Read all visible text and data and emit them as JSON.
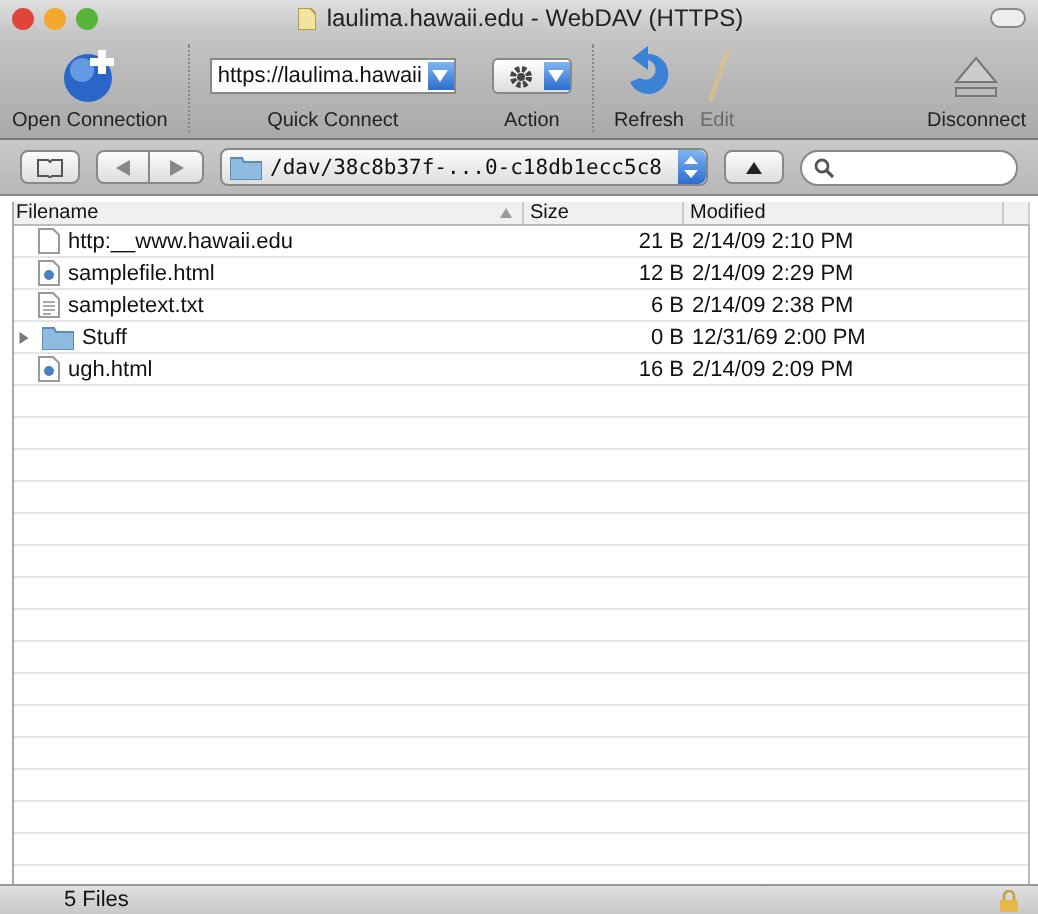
{
  "window": {
    "title": "laulima.hawaii.edu - WebDAV (HTTPS)"
  },
  "toolbar": [
    {
      "kind": "open",
      "label": "Open Connection",
      "disabled": false
    },
    {
      "kind": "quick",
      "label": "Quick Connect",
      "value": "https://laulima.hawaii",
      "disabled": false
    },
    {
      "kind": "action",
      "label": "Action",
      "disabled": false
    },
    {
      "kind": "refresh",
      "label": "Refresh",
      "disabled": false
    },
    {
      "kind": "edit",
      "label": "Edit",
      "disabled": true
    },
    {
      "kind": "disconnect",
      "label": "Disconnect",
      "disabled": false
    }
  ],
  "path": {
    "value": "/dav/38c8b37f-...0-c18db1ecc5c8"
  },
  "table": {
    "columns": [
      "Filename",
      "Size",
      "Modified"
    ],
    "rows": [
      {
        "kind": "file",
        "name": "http:__www.hawaii.edu",
        "size": "21 B",
        "modified": "2/14/09 2:10 PM"
      },
      {
        "kind": "html",
        "name": "samplefile.html",
        "size": "12 B",
        "modified": "2/14/09 2:29 PM"
      },
      {
        "kind": "text",
        "name": "sampletext.txt",
        "size": "6 B",
        "modified": "2/14/09 2:38 PM"
      },
      {
        "kind": "folder",
        "name": "Stuff",
        "size": "0 B",
        "modified": "12/31/69 2:00 PM",
        "expanded": false
      },
      {
        "kind": "html",
        "name": "ugh.html",
        "size": "16 B",
        "modified": "2/14/09 2:09 PM"
      }
    ]
  },
  "status_bar": {
    "text": "5 Files"
  }
}
